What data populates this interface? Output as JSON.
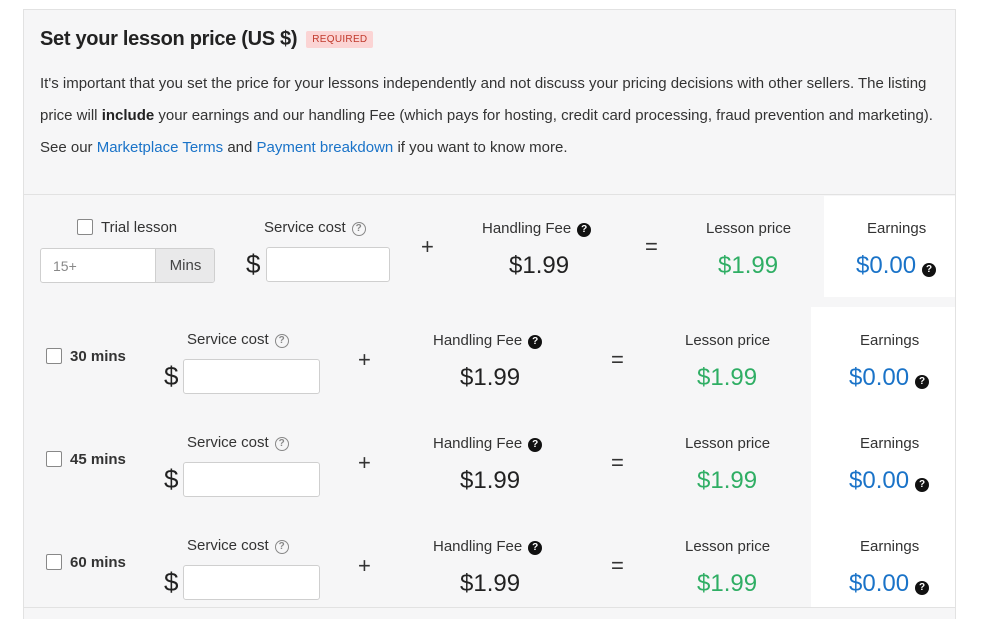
{
  "header": {
    "title": "Set your lesson price (US $)",
    "badge": "REQUIRED",
    "desc_part1": "It's important that you set the price for your lessons independently and not discuss your pricing decisions with other sellers. The listing price will ",
    "desc_bold": "include",
    "desc_part2": " your earnings and our handling Fee (which pays for hosting, credit card processing, fraud prevention and marketing). See our ",
    "link_terms": "Marketplace Terms",
    "desc_and": " and ",
    "link_breakdown": "Payment breakdown",
    "desc_end": " if you want to know more."
  },
  "labels": {
    "service_cost": "Service cost",
    "handling_fee": "Handling Fee",
    "lesson_price": "Lesson price",
    "earnings": "Earnings",
    "plus": "+",
    "equals": "=",
    "currency": "$"
  },
  "trial": {
    "label": "Trial lesson",
    "mins_placeholder": "15+",
    "mins_addon": "Mins",
    "handling_fee": "$1.99",
    "lesson_price": "$1.99",
    "earnings": "$0.00"
  },
  "rows": [
    {
      "label": "30 mins",
      "handling_fee": "$1.99",
      "lesson_price": "$1.99",
      "earnings": "$0.00"
    },
    {
      "label": "45 mins",
      "handling_fee": "$1.99",
      "lesson_price": "$1.99",
      "earnings": "$0.00"
    },
    {
      "label": "60 mins",
      "handling_fee": "$1.99",
      "lesson_price": "$1.99",
      "earnings": "$0.00"
    }
  ],
  "icons": {
    "help": "question-circle-icon",
    "info": "question-filled-icon"
  },
  "colors": {
    "accent_blue": "#1a73c8",
    "price_green": "#2fae64",
    "required_red": "#c0392b"
  }
}
